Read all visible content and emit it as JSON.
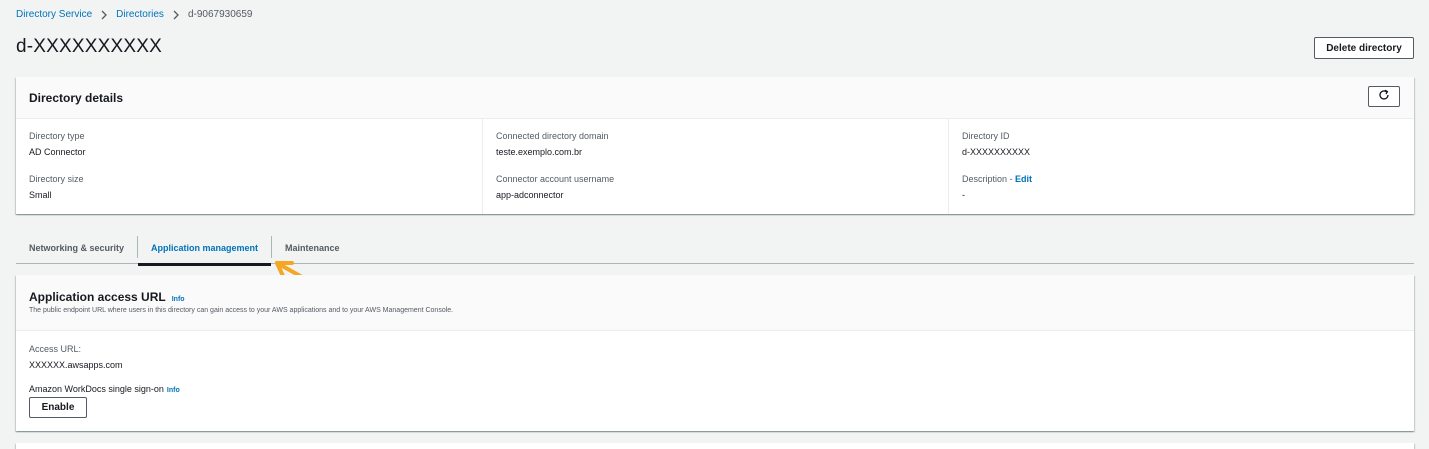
{
  "breadcrumb": {
    "items": [
      "Directory Service",
      "Directories"
    ],
    "current": "d-9067930659"
  },
  "page": {
    "title": "d-XXXXXXXXXX",
    "delete_label": "Delete directory"
  },
  "details": {
    "title": "Directory details",
    "directory_type_label": "Directory type",
    "directory_type_value": "AD Connector",
    "directory_size_label": "Directory size",
    "directory_size_value": "Small",
    "domain_label": "Connected directory domain",
    "domain_value": "teste.exemplo.com.br",
    "username_label": "Connector account username",
    "username_value": "app-adconnector",
    "directory_id_label": "Directory ID",
    "directory_id_value": "d-XXXXXXXXXX",
    "description_label": "Description - ",
    "description_edit": "Edit",
    "description_value": "-"
  },
  "tabs": [
    {
      "label": "Networking & security",
      "active": false
    },
    {
      "label": "Application management",
      "active": true
    },
    {
      "label": "Maintenance",
      "active": false
    }
  ],
  "app_access": {
    "title": "Application access URL",
    "info": "Info",
    "description": "The public endpoint URL where users in this directory can gain access to your AWS applications and to your AWS Management Console.",
    "access_url_label": "Access URL:",
    "access_url_value": "XXXXXX.awsapps.com",
    "workdocs_label": "Amazon WorkDocs single sign-on",
    "workdocs_info": "Info",
    "enable_label": "Enable"
  },
  "colors": {
    "link": "#0073bb",
    "arrow": "#f5a623",
    "background": "#f2f3f3"
  }
}
